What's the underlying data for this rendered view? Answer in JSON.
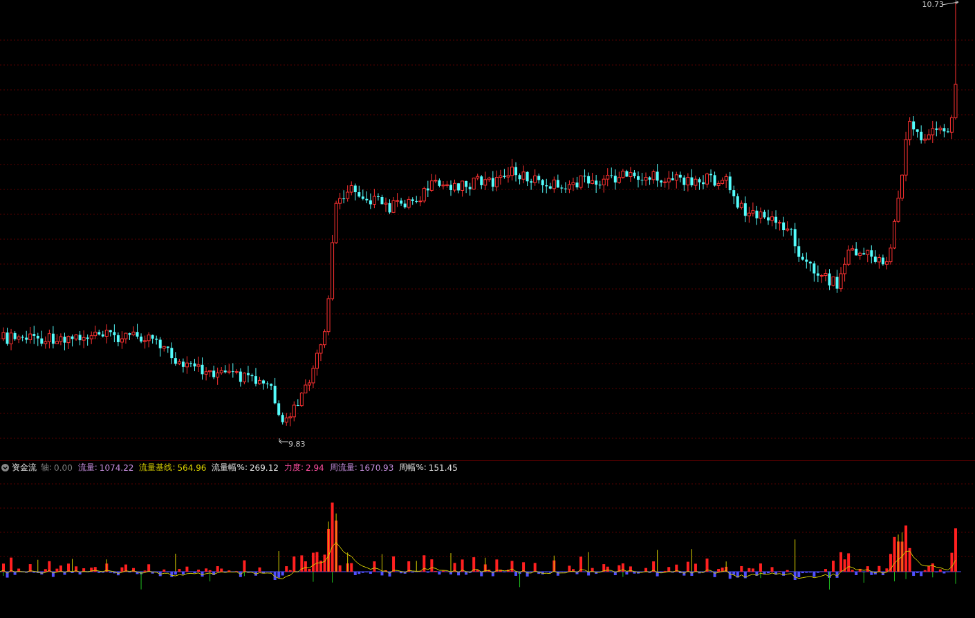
{
  "price_chart": {
    "high_label": "10.73",
    "low_label": "9.83"
  },
  "indicator": {
    "title": "资金流",
    "items": [
      {
        "label": "轴:",
        "value": "0.00",
        "color": "#808080"
      },
      {
        "label": "流量:",
        "value": "1074.22",
        "color": "#c890e0"
      },
      {
        "label": "流量基线:",
        "value": "564.96",
        "color": "#d8d000"
      },
      {
        "label": "流量幅%:",
        "value": "269.12",
        "color": "#e0e0e0"
      },
      {
        "label": "力度:",
        "value": "2.94",
        "color": "#ff4fa0"
      },
      {
        "label": "周流量:",
        "value": "1670.93",
        "color": "#c890e0"
      },
      {
        "label": "周幅%:",
        "value": "151.45",
        "color": "#e0e0e0"
      }
    ]
  }
}
